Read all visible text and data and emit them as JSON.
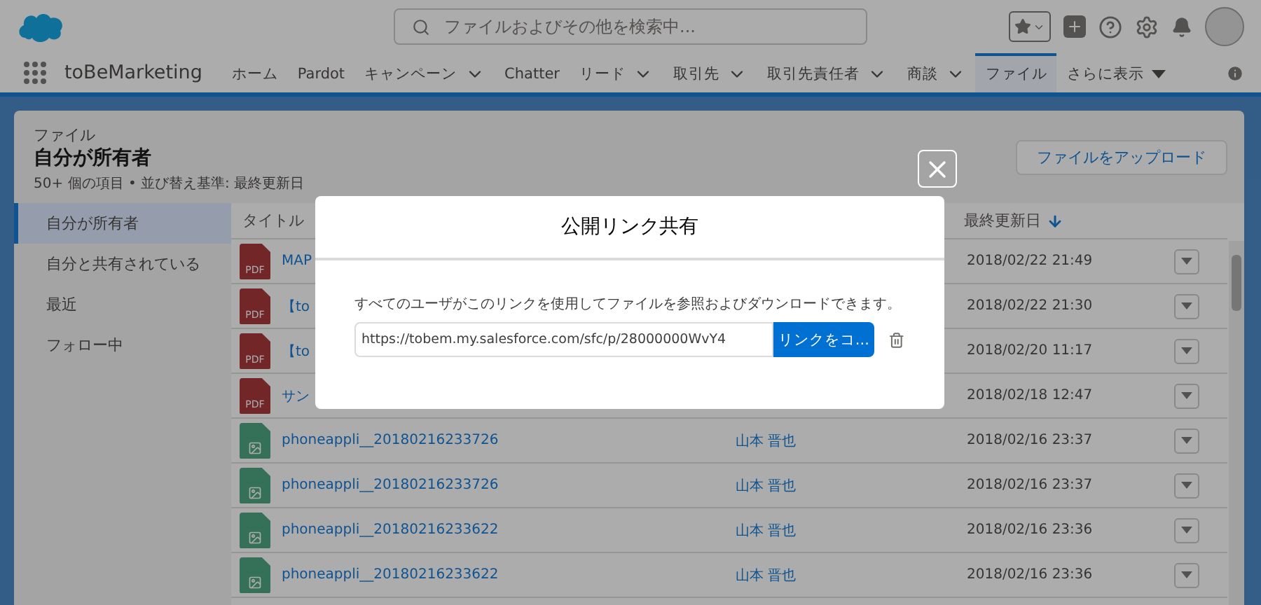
{
  "header": {
    "search_placeholder": "ファイルおよびその他を検索中..."
  },
  "nav": {
    "app_name": "toBeMarketing",
    "tabs": [
      {
        "label": "ホーム",
        "has_menu": false,
        "selected": false
      },
      {
        "label": "Pardot",
        "has_menu": false,
        "selected": false
      },
      {
        "label": "キャンペーン",
        "has_menu": true,
        "selected": false
      },
      {
        "label": "Chatter",
        "has_menu": false,
        "selected": false
      },
      {
        "label": "リード",
        "has_menu": true,
        "selected": false
      },
      {
        "label": "取引先",
        "has_menu": true,
        "selected": false
      },
      {
        "label": "取引先責任者",
        "has_menu": true,
        "selected": false
      },
      {
        "label": "商談",
        "has_menu": true,
        "selected": false
      },
      {
        "label": "ファイル",
        "has_menu": false,
        "selected": true
      }
    ],
    "more": "さらに表示"
  },
  "page": {
    "object": "ファイル",
    "title": "自分が所有者",
    "subtitle": "50+ 個の項目 • 並び替え基準: 最終更新日",
    "upload_button": "ファイルをアップロード"
  },
  "sidebar": {
    "items": [
      {
        "label": "自分が所有者",
        "selected": true
      },
      {
        "label": "自分と共有されている",
        "selected": false
      },
      {
        "label": "最近",
        "selected": false
      },
      {
        "label": "フォロー中",
        "selected": false
      }
    ]
  },
  "table": {
    "columns": [
      {
        "label": "タイトル",
        "sorted": false
      },
      {
        "label": "最終更新日",
        "sorted": true
      }
    ],
    "rows": [
      {
        "kind": "pdf",
        "badge": "PDF",
        "title": "MAP",
        "date": "2018/02/22 21:49"
      },
      {
        "kind": "pdf",
        "badge": "PDF",
        "title": "【to",
        "date": "2018/02/22 21:30"
      },
      {
        "kind": "pdf",
        "badge": "PDF",
        "title": "【to",
        "date": "2018/02/20 11:17"
      },
      {
        "kind": "pdf",
        "badge": "PDF",
        "title": "サン",
        "date": "2018/02/18 12:47"
      },
      {
        "kind": "image",
        "title": "phoneappli__20180216233726",
        "owner": "山本 晋也",
        "date": "2018/02/16 23:37"
      },
      {
        "kind": "image",
        "title": "phoneappli__20180216233726",
        "owner": "山本 晋也",
        "date": "2018/02/16 23:37"
      },
      {
        "kind": "image",
        "title": "phoneappli__20180216233622",
        "owner": "山本 晋也",
        "date": "2018/02/16 23:36"
      },
      {
        "kind": "image",
        "title": "phoneappli__20180216233622",
        "owner": "山本 晋也",
        "date": "2018/02/16 23:36"
      }
    ]
  },
  "modal": {
    "title": "公開リンク共有",
    "message": "すべてのユーザがこのリンクを使用してファイルを参照およびダウンロードできます。",
    "link": "https://tobem.my.salesforce.com/sfc/p/28000000WvY4",
    "copy_button": "リンクをコ..."
  }
}
